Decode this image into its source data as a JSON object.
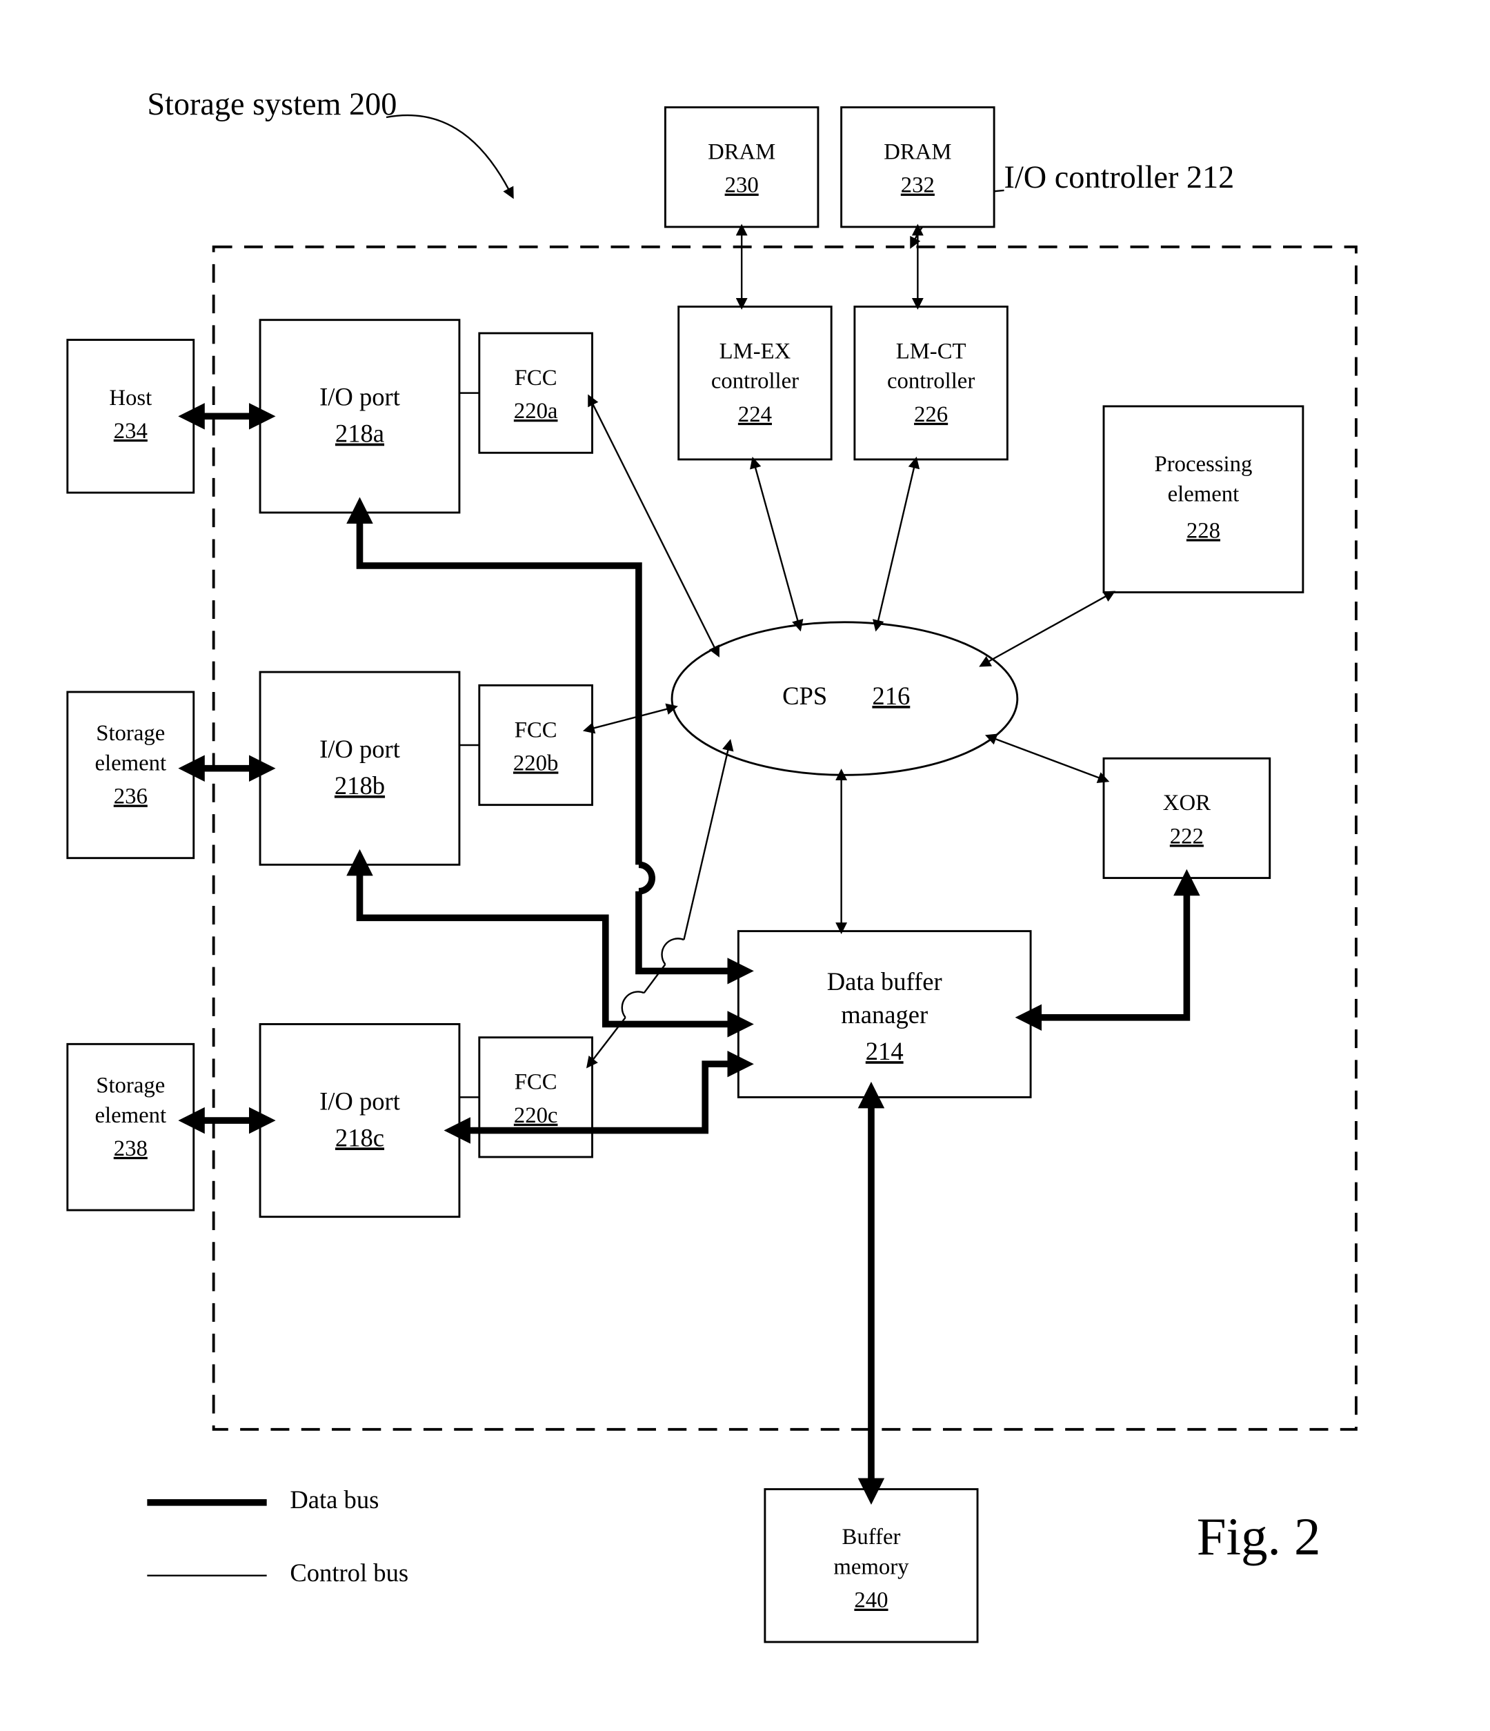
{
  "title": "Storage system 200",
  "io_controller_label": "I/O controller 212",
  "figure_label": "Fig. 2",
  "legend": {
    "data_bus": "Data bus",
    "control_bus": "Control bus"
  },
  "host": {
    "label": "Host",
    "ref": "234"
  },
  "storage1": {
    "line1": "Storage",
    "line2": "element",
    "ref": "236"
  },
  "storage2": {
    "line1": "Storage",
    "line2": "element",
    "ref": "238"
  },
  "ioport_a": {
    "label": "I/O port",
    "ref": "218a"
  },
  "ioport_b": {
    "label": "I/O port",
    "ref": "218b"
  },
  "ioport_c": {
    "label": "I/O port",
    "ref": "218c"
  },
  "fcc_a": {
    "label": "FCC",
    "ref": "220a"
  },
  "fcc_b": {
    "label": "FCC",
    "ref": "220b"
  },
  "fcc_c": {
    "label": "FCC",
    "ref": "220c"
  },
  "dram1": {
    "label": "DRAM",
    "ref": "230"
  },
  "dram2": {
    "label": "DRAM",
    "ref": "232"
  },
  "lmex": {
    "line1": "LM-EX",
    "line2": "controller",
    "ref": "224"
  },
  "lmct": {
    "line1": "LM-CT",
    "line2": "controller",
    "ref": "226"
  },
  "proc": {
    "line1": "Processing",
    "line2": "element",
    "ref": "228"
  },
  "cps": {
    "label": "CPS",
    "ref": "216"
  },
  "xor": {
    "label": "XOR",
    "ref": "222"
  },
  "dbm": {
    "line1": "Data buffer",
    "line2": "manager",
    "ref": "214"
  },
  "bufmem": {
    "line1": "Buffer",
    "line2": "memory",
    "ref": "240"
  }
}
